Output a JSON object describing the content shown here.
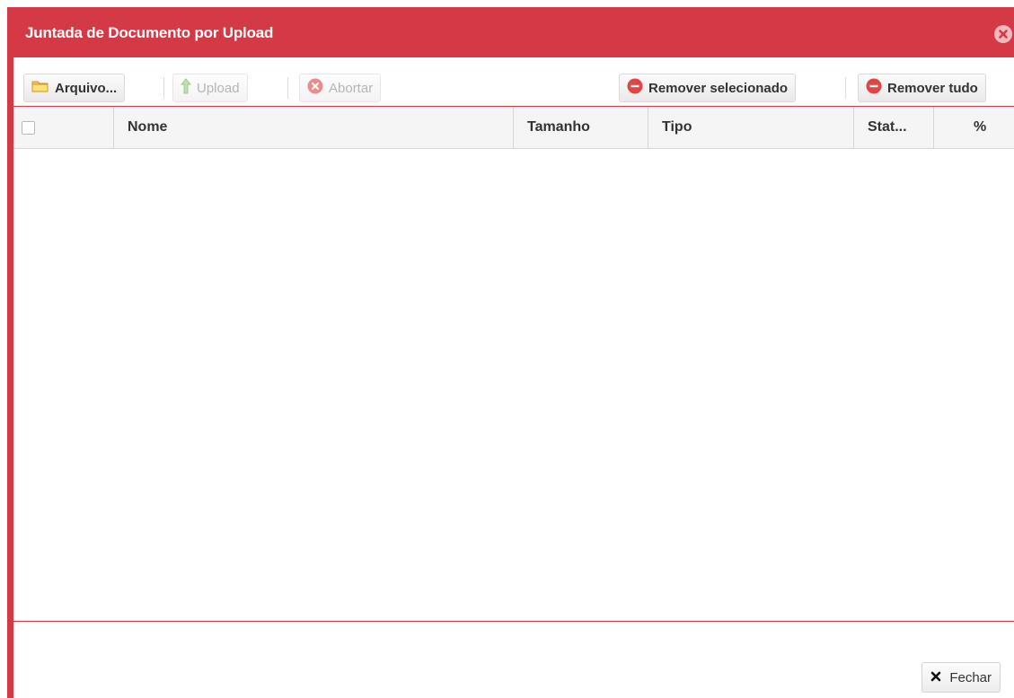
{
  "dialog": {
    "title": "Juntada de Documento por Upload"
  },
  "toolbar": {
    "arquivo_label": "Arquivo...",
    "upload_label": "Upload",
    "abortar_label": "Abortar",
    "remover_selecionado_label": "Remover selecionado",
    "remover_tudo_label": "Remover tudo"
  },
  "grid": {
    "columns": [
      "Nome",
      "Tamanho",
      "Tipo",
      "Stat...",
      "%"
    ],
    "rows": []
  },
  "footer": {
    "fechar_label": "Fechar"
  },
  "colors": {
    "accent": "#d33a45",
    "header_bg": "#f5f5f5"
  },
  "icons": {
    "close": "close-circle-icon",
    "arquivo": "folder-icon",
    "upload": "arrow-up-icon",
    "abortar": "cancel-circle-icon",
    "remover": "minus-circle-icon",
    "fechar": "x-icon"
  }
}
